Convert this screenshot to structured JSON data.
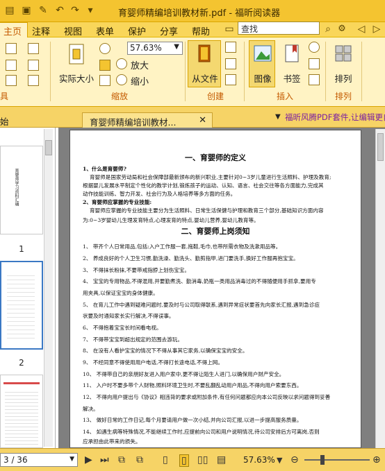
{
  "window": {
    "title": "育婴师精编培训教材新.pdf - 福昕阅读器"
  },
  "ribbon_tabs": [
    "主页",
    "注释",
    "视图",
    "表单",
    "保护",
    "分享",
    "帮助"
  ],
  "active_tab": "主页",
  "search": {
    "value": "查找"
  },
  "ribbon": {
    "actual_size_label": "实际大小",
    "zoom_value": "57.63%",
    "zoom_in_label": "放大",
    "zoom_out_label": "缩小",
    "from_file_label": "从文件",
    "image_label": "图像",
    "bookmark_label": "书签",
    "arrange_label": "排列",
    "groups": {
      "tools": "具",
      "zoom": "缩放",
      "create": "创建",
      "insert": "插入",
      "arrange": "排列"
    }
  },
  "doc_tabs": {
    "left_partial": "始",
    "active_tab": "育婴师精编培训教材...",
    "ad_text": "福昕风腾PDF套件,让编辑更自"
  },
  "thumbnails": {
    "page1_text": "育婴师学习资料汇编",
    "labels": [
      "1",
      "2"
    ]
  },
  "document": {
    "heading1": "一、育婴师的定义",
    "sub1": "1、什么是育婴师?",
    "para1a": "育婴师是国家劳动局和社会保障部最新颁布的新兴职业,主要针对0~3岁儿童进行生活照料、护理及教育;",
    "para1b": "根据婴儿发展水平制定个性化的教学计划,锻炼孩子的运动、认知、语言、社会交往等各方面能力,完成其",
    "para1c": "动作技能训练、智力开发、社会行为及人格培养等多方面的任务。",
    "sub2": "2、育婴师应掌握的专业技能:",
    "para2a": "育婴师应掌握的专业技能主要分为生活照料、日常生活保健与护理和教育三个部分,基础知识方面内容",
    "para2b": "为:0~3岁婴幼儿生理发育特点,心理发育的特点,婴幼儿营养,婴幼儿教育等。",
    "heading2": "二、育婴师上岗须知",
    "items": [
      "1、 带齐个人日常用品,包括:入户工作服一套,拖鞋,毛巾,也带所需衣物及洗漱用品等。",
      "2、 养成良好的个人卫生习惯,勤洗澡、勤洗头、勤剪指甲,进门要洗手,换好工作服再抱宝宝。",
      "3、 不得抹长粉抹,不要带戒指脖上划伤宝宝。",
      "4、 宝宝的专用物品,不得混用,并要勤煮洗、勤消毒,奶瓶一类用品消毒过的不得随便用手抓拿,要用专",
      "     用夹具,以保证宝宝的身体健康。",
      "5、 在育儿工作中遇到疑难问题时,要及时与公司取得联系,遇到异常症状要首先向家长汇报,遇到急诊症",
      "     状要及时通知家长实行解决,不得误事。",
      "6、 不得抱着宝宝长时间看电视。",
      "7、 不得带宝宝到超出规定的范围去游玩。",
      "8、 在没有人看护宝宝的情况下不得从事其它家务,以确保宝宝的安全。",
      "9、 不经同意不得使用用户电话,不得打长途电话,不得上网。",
      "10、 不得带自己的亲朋好友进入用户家中,更不得让陌生人进门,以确保用户财产安全。",
      "11、 入户时不要多带个人财物,照料环境卫生时,不要乱翻乱动用户用品,不得向用户索要东西。",
      "12、 不得向用户提出与《协议》相违背的要求或附加条件,有任何问题都应向本公司反映以求问题得到妥善",
      "     解决。",
      "13、 做好日常的工作日记,每个月要请用户做一次小结,并向公司汇报,以进一步提高服务质量。",
      "14、 如遇生病等特殊情况,不能继续工作时,应提前向公司和用户说明情况,待公司安排后方可离岗,否则",
      "     应承担由此带来的损失。"
    ]
  },
  "status": {
    "page_field": "3 / 36",
    "zoom": "57.63%"
  }
}
